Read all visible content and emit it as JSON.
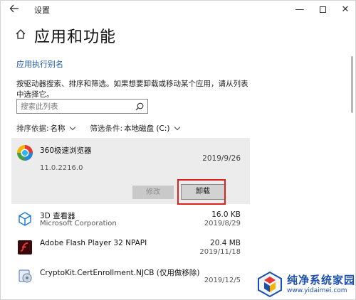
{
  "window": {
    "title": "设置",
    "controls": {
      "minimize": "—",
      "close": "✕"
    }
  },
  "header": {
    "title": "应用和功能"
  },
  "alias_link": "应用执行别名",
  "description": "按驱动器搜索、排序和筛选。如果想要卸载或移动某个应用，请从列表中选择它。",
  "search": {
    "placeholder": "搜索此列表"
  },
  "sort": {
    "label": "排序依据:",
    "value": "名称"
  },
  "filter": {
    "label": "筛选条件:",
    "value": "本地磁盘 (C:)"
  },
  "selected_app": {
    "name": "360极速浏览器",
    "date": "2019/9/26",
    "version": "11.0.2216.0",
    "modify_label": "修改",
    "uninstall_label": "卸载"
  },
  "apps": [
    {
      "name": "3D 查看器",
      "publisher": "Microsoft Corporation",
      "size": "16.0 KB",
      "date": "2019/8/29",
      "icon": "cube-icon"
    },
    {
      "name": "Adobe Flash Player 32 NPAPI",
      "publisher": "",
      "size": "20.4 MB",
      "date": "2019/11/18",
      "icon": "flash-icon"
    },
    {
      "name": "CryptoKit.CertEnrollment.NJCB (仅用做移除)",
      "publisher": "",
      "size": "",
      "date": "2019/12/5",
      "icon": "installer-icon"
    }
  ],
  "watermark": {
    "main": "纯净系统家园",
    "url": "www.yidaimei.com"
  },
  "colors": {
    "link": "#1a56b0",
    "highlight_outline": "#e0201a",
    "selected_bg": "#ececec"
  }
}
